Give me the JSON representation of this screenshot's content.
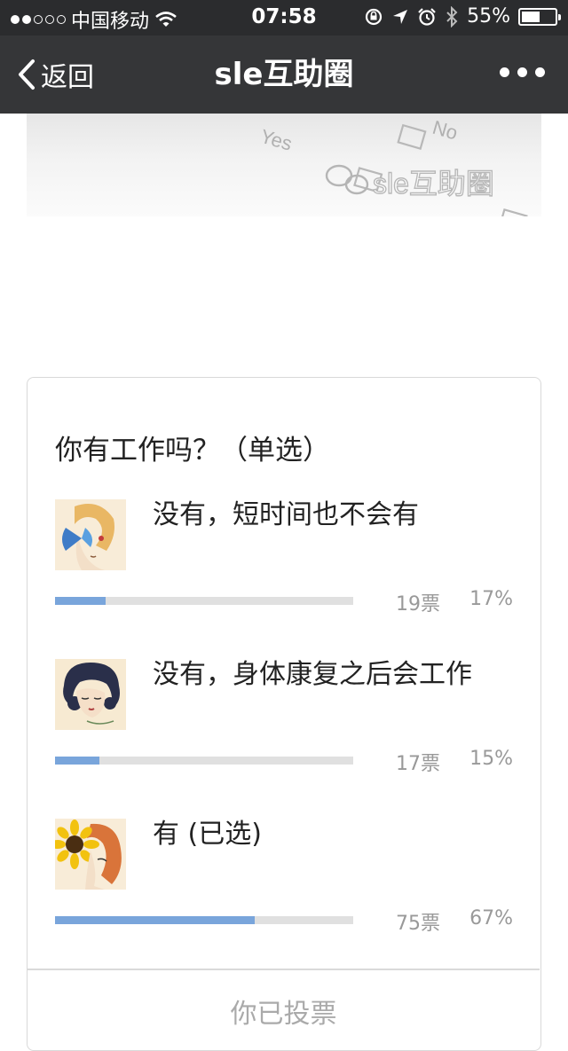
{
  "status_bar": {
    "carrier": "中国移动",
    "time": "07:58",
    "battery": "55%",
    "battery_level": 0.55
  },
  "nav": {
    "back_label": "返回",
    "title": "sle互助圈"
  },
  "banner": {
    "yes_text": "Yes",
    "no_text": "No",
    "watermark": "sle互助圈"
  },
  "poll": {
    "question": "你有工作吗？（单选）",
    "options": [
      {
        "label": "没有，短时间也不会有",
        "votes": "19票",
        "percent": "17%",
        "share": 0.17,
        "avatar_icon": "butterfly-girl-icon"
      },
      {
        "label": "没有，身体康复之后会工作",
        "votes": "17票",
        "percent": "15%",
        "share": 0.15,
        "avatar_icon": "dark-hair-girl-icon"
      },
      {
        "label": "有 (已选)",
        "votes": "75票",
        "percent": "67%",
        "share": 0.67,
        "avatar_icon": "sunflower-girl-icon"
      }
    ],
    "footer": "你已投票"
  },
  "colors": {
    "status_bg": "#2b2c2e",
    "nav_bg": "#353638",
    "bar_fill": "#79a5db",
    "bar_track": "#e0e0e0"
  }
}
